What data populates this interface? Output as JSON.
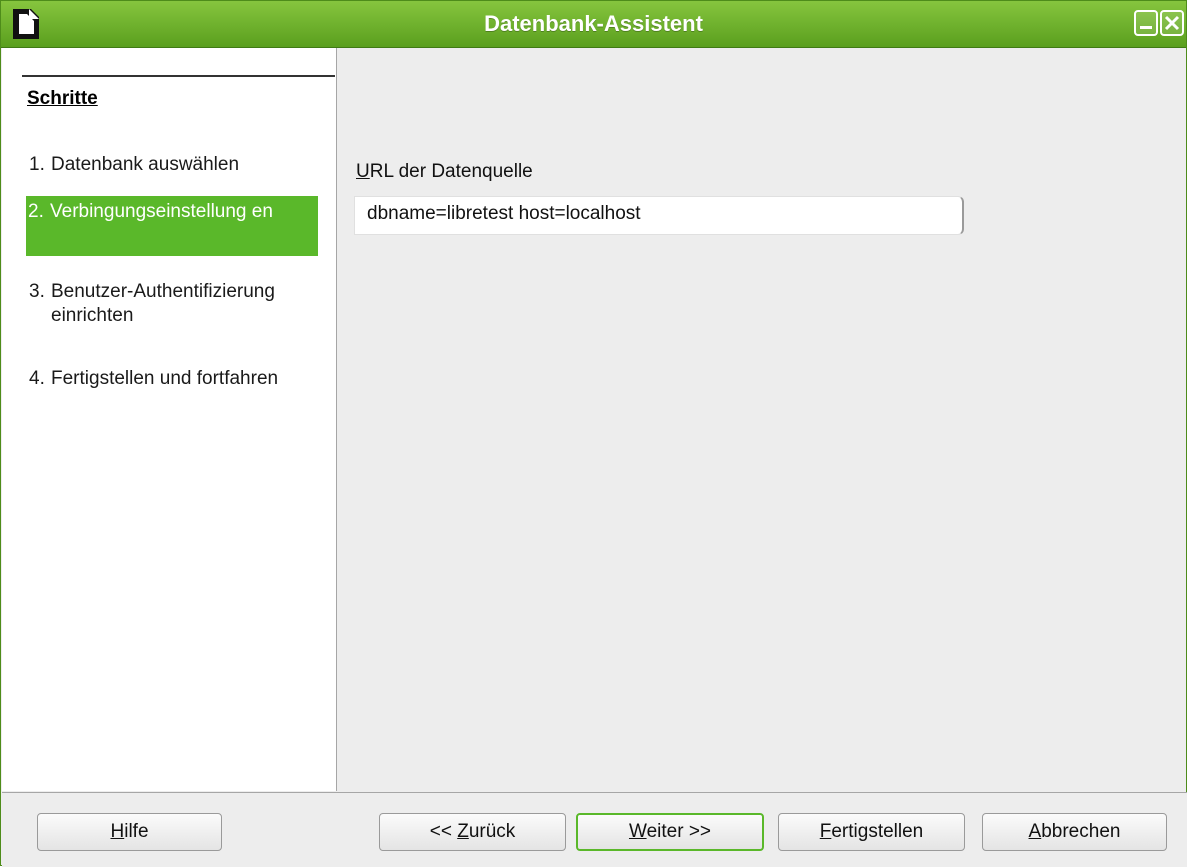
{
  "window": {
    "title": "Datenbank-Assistent"
  },
  "sidebar": {
    "heading": "Schritte",
    "steps": [
      {
        "num": "1.",
        "label": "Datenbank auswählen",
        "active": false
      },
      {
        "num": "2.",
        "label": "Verbingungseinstellung en",
        "active": true
      },
      {
        "num": "3.",
        "label": "Benutzer-Authentifizierung einrichten",
        "active": false
      },
      {
        "num": "4.",
        "label": "Fertigstellen und fortfahren",
        "active": false
      }
    ]
  },
  "main": {
    "url_label_accel": "U",
    "url_label_rest": "RL der Datenquelle",
    "url_value": "dbname=libretest host=localhost"
  },
  "footer": {
    "help": {
      "accel": "H",
      "rest": "ilfe"
    },
    "back": {
      "prefix": "<< ",
      "accel": "Z",
      "rest": "urück"
    },
    "next": {
      "accel": "W",
      "rest": "eiter >>"
    },
    "finish": {
      "accel": "F",
      "rest": "ertigstellen"
    },
    "cancel": {
      "accel": "A",
      "rest": "bbrechen"
    }
  },
  "colors": {
    "titlebar": "#6cb22c",
    "active_step": "#5ab82a",
    "default_button_border": "#5ab82a"
  }
}
